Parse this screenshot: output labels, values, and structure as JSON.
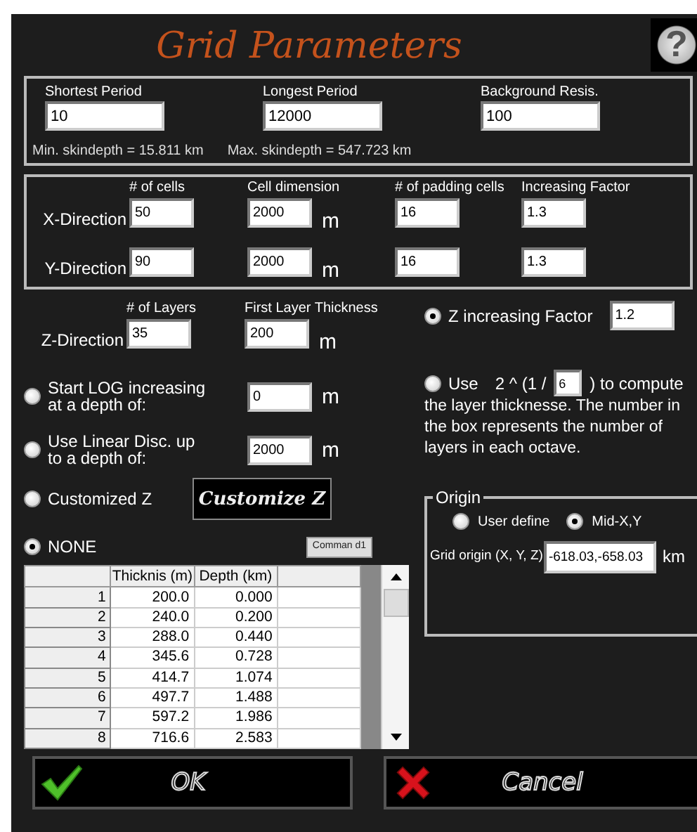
{
  "title": "Grid Parameters",
  "help_button": "?",
  "period_box": {
    "fields": [
      {
        "label": "Shortest Period",
        "value": "10"
      },
      {
        "label": "Longest Period",
        "value": "12000"
      },
      {
        "label": "Background Resis.",
        "value": "100"
      }
    ],
    "notes": [
      "Min. skindepth = 15.811 km",
      "Max. skindepth = 547.723 km"
    ]
  },
  "xy_grid": {
    "columns": [
      "# of cells",
      "Cell dimension",
      "# of padding cells",
      "Increasing Factor"
    ],
    "rows": [
      {
        "label": "X-Direction",
        "values": [
          "50",
          "2000",
          "16",
          "1.3"
        ],
        "unit": "m"
      },
      {
        "label": "Y-Direction",
        "values": [
          "90",
          "2000",
          "16",
          "1.3"
        ],
        "unit": "m"
      }
    ]
  },
  "z_direction": {
    "label": "Z-Direction",
    "columns": [
      "# of Layers",
      "First Layer Thickness"
    ],
    "values": [
      "35",
      "200"
    ],
    "unit": "m"
  },
  "z_factor": {
    "label": "Z increasing Factor",
    "value": "1.2",
    "selected": true
  },
  "depth_options": [
    {
      "label": "Start LOG increasing at a depth of:",
      "value": "0",
      "unit": "m",
      "selected": false
    },
    {
      "label": "Use Linear Disc. up to a depth of:",
      "value": "2000",
      "unit": "m",
      "selected": false
    }
  ],
  "customized": {
    "label": "Customized Z",
    "selected": false,
    "button": "Customize Z"
  },
  "none_option": {
    "label": "NONE",
    "selected": true,
    "button": "Comman d1"
  },
  "octave": {
    "prefix": "Use",
    "formula": "2 ^ (1 /",
    "value": "6",
    "suffix": ") to compute",
    "text": "the layer thicknesse. The number in the box represents the number of layers in each octave.",
    "selected": false
  },
  "origin": {
    "legend": "Origin",
    "options": [
      {
        "label": "User define",
        "selected": false
      },
      {
        "label": "Mid-X,Y",
        "selected": true
      }
    ],
    "field_label": "Grid origin (X, Y, Z)",
    "value": "-618.03,-658.03",
    "unit": "km"
  },
  "table": {
    "columns": [
      "Thicknis (m)",
      "Depth (km)"
    ],
    "rows": [
      {
        "index": "1",
        "thickness": "200.0",
        "depth": "0.000"
      },
      {
        "index": "2",
        "thickness": "240.0",
        "depth": "0.200"
      },
      {
        "index": "3",
        "thickness": "288.0",
        "depth": "0.440"
      },
      {
        "index": "4",
        "thickness": "345.6",
        "depth": "0.728"
      },
      {
        "index": "5",
        "thickness": "414.7",
        "depth": "1.074"
      },
      {
        "index": "6",
        "thickness": "497.7",
        "depth": "1.488"
      },
      {
        "index": "7",
        "thickness": "597.2",
        "depth": "1.986"
      },
      {
        "index": "8",
        "thickness": "716.6",
        "depth": "2.583"
      }
    ]
  },
  "buttons": [
    {
      "kind": "ok",
      "label": "OK"
    },
    {
      "kind": "cancel",
      "label": "Cancel"
    }
  ]
}
